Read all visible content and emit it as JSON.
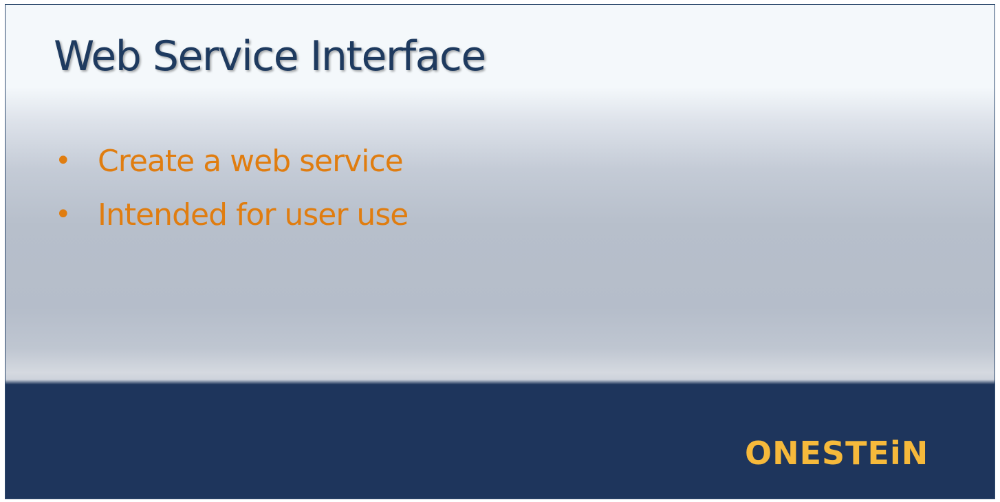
{
  "slide": {
    "title": "Web Service Interface",
    "bullets": [
      {
        "text": "Create a web service"
      },
      {
        "text": "Intended for user use"
      }
    ],
    "logo_text": "ONESTEiN"
  },
  "colors": {
    "title": "#1e3a5f",
    "bullet_text": "#e07d10",
    "footer_band": "#1e355c",
    "logo": "#f6b93b"
  }
}
